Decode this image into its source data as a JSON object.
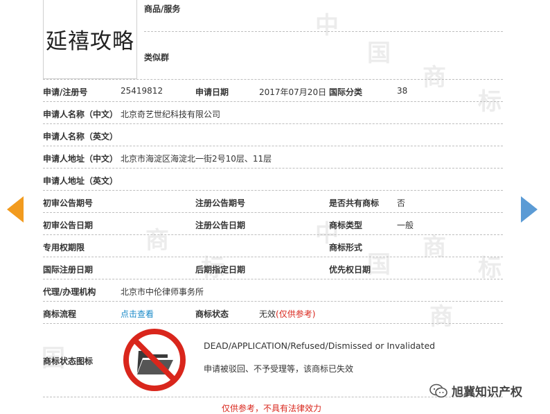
{
  "logo": {
    "text": "延禧攻略"
  },
  "goods_label": "商品/服务",
  "similar_label": "类似群",
  "rows": [
    {
      "label": "申请/注册号",
      "value": "25419812",
      "label2": "申请日期",
      "value2": "2017年07月20日",
      "label3": "国际分类",
      "value3": "38"
    },
    {
      "label": "申请人名称（中文）",
      "value": "北京奇艺世纪科技有限公司"
    },
    {
      "label": "申请人名称（英文）",
      "value": ""
    },
    {
      "label": "申请人地址（中文）",
      "value": "北京市海淀区海淀北一街2号10层、11层"
    },
    {
      "label": "申请人地址（英文）",
      "value": ""
    },
    {
      "label": "初审公告期号",
      "value": "",
      "label2": "注册公告期号",
      "value2": "",
      "label3": "是否共有商标",
      "value3": "否"
    },
    {
      "label": "初审公告日期",
      "value": "",
      "label2": "注册公告日期",
      "value2": "",
      "label3": "商标类型",
      "value3": "一般"
    },
    {
      "label": "专用权期限",
      "value": "",
      "label3": "商标形式",
      "value3": ""
    },
    {
      "label": "国际注册日期",
      "value": "",
      "label2": "后期指定日期",
      "value2": "",
      "label3": "优先权日期",
      "value3": ""
    },
    {
      "label": "代理/办理机构",
      "value": "北京市中伦律师事务所"
    },
    {
      "label": "商标流程",
      "value": "点击查看",
      "label2": "商标状态",
      "value2": "无效",
      "value2_note": "(仅供参考)"
    }
  ],
  "status_icon_label": "商标状态图标",
  "status_en": "DEAD/APPLICATION/Refused/Dismissed or Invalidated",
  "status_cn": "申请被驳回、不予受理等，该商标已失效",
  "footer": "仅供参考，不具有法律效力",
  "wechat": {
    "name": "旭冀知识产权"
  },
  "watermark": {
    "chars": [
      "中",
      "国",
      "商",
      "标"
    ]
  },
  "colors": {
    "link": "#1a8ac8",
    "red": "#d9261c",
    "arrow_left": "#f29b1e",
    "arrow_right": "#5b9bd5"
  }
}
